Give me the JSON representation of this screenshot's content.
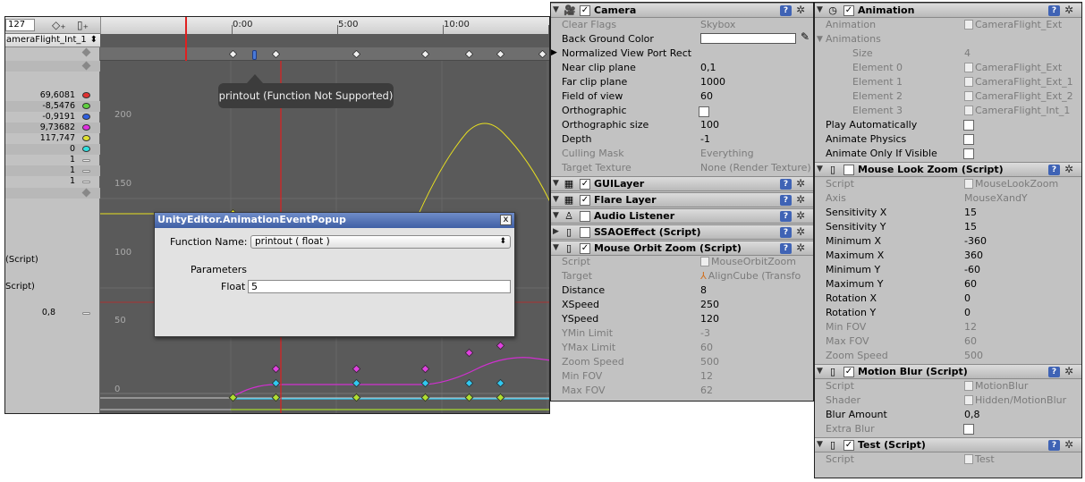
{
  "animation": {
    "frame_field": "127",
    "clip_name": "ameraFlight_Int_1",
    "ruler_labels": [
      "0:00",
      "5:00",
      "10:00"
    ],
    "tracks": [
      {
        "value": "69,6081",
        "color": "#e03030"
      },
      {
        "value": "-8,5476",
        "color": "#60d040"
      },
      {
        "value": "-0,9191",
        "color": "#3060e0"
      },
      {
        "value": "9,73682",
        "color": "#e030e0"
      },
      {
        "value": "117,747",
        "color": "#e0e030"
      },
      {
        "value": "0",
        "color": "#30e0e0"
      },
      {
        "value": "1",
        "color": ""
      },
      {
        "value": "1",
        "color": ""
      },
      {
        "value": "1",
        "color": ""
      }
    ],
    "script_label_1": "(Script)",
    "script_label_2": "Script)",
    "blur_value": "0,8",
    "y_labels": [
      "200",
      "150",
      "100",
      "50",
      "0"
    ],
    "tooltip": "printout (Function Not Supported)"
  },
  "popup": {
    "title": "UnityEditor.AnimationEventPopup",
    "close": "x",
    "function_label": "Function Name:",
    "function_value": "printout ( float )",
    "parameters_label": "Parameters",
    "float_label": "Float",
    "float_value": "5"
  },
  "inspector_a": {
    "camera": {
      "name": "Camera",
      "props": [
        {
          "label": "Clear Flags",
          "value": "Skybox",
          "dim": true
        },
        {
          "label": "Back Ground Color",
          "value": "",
          "dim": false
        },
        {
          "label": "Normalized View Port Rect",
          "value": "",
          "dim": false
        },
        {
          "label": "Near clip plane",
          "value": "0,1",
          "dim": false
        },
        {
          "label": "Far clip plane",
          "value": "1000",
          "dim": false
        },
        {
          "label": "Field of view",
          "value": "60",
          "dim": false
        },
        {
          "label": "Orthographic",
          "value": "",
          "dim": false
        },
        {
          "label": "Orthographic size",
          "value": "100",
          "dim": false
        },
        {
          "label": "Depth",
          "value": "-1",
          "dim": false
        },
        {
          "label": "Culling Mask",
          "value": "Everything",
          "dim": true
        },
        {
          "label": "Target Texture",
          "value": "None (Render Texture)",
          "dim": true
        }
      ]
    },
    "gui_layer": "GUILayer",
    "flare_layer": "Flare Layer",
    "audio_listener": "Audio Listener",
    "ssao": "SSAOEffect (Script)",
    "orbit": {
      "name": "Mouse Orbit Zoom (Script)",
      "script_label": "Script",
      "script_value": "MouseOrbitZoom",
      "target_label": "Target",
      "target_value": "AlignCube (Transfo",
      "props": [
        {
          "label": "Distance",
          "value": "8",
          "dim": false
        },
        {
          "label": "XSpeed",
          "value": "250",
          "dim": false
        },
        {
          "label": "YSpeed",
          "value": "120",
          "dim": false
        },
        {
          "label": "YMin Limit",
          "value": "-3",
          "dim": true
        },
        {
          "label": "YMax Limit",
          "value": "60",
          "dim": true
        },
        {
          "label": "Zoom Speed",
          "value": "500",
          "dim": true
        },
        {
          "label": "Min FOV",
          "value": "12",
          "dim": true
        },
        {
          "label": "Max FOV",
          "value": "62",
          "dim": true
        }
      ]
    },
    "help": "?",
    "gear": "✲"
  },
  "inspector_b": {
    "animation": {
      "name": "Animation",
      "animation_label": "Animation",
      "animation_value": "CameraFlight_Ext",
      "animations_label": "Animations",
      "size_label": "Size",
      "size_value": "4",
      "elements": [
        {
          "label": "Element 0",
          "value": "CameraFlight_Ext"
        },
        {
          "label": "Element 1",
          "value": "CameraFlight_Ext_1"
        },
        {
          "label": "Element 2",
          "value": "CameraFlight_Ext_2"
        },
        {
          "label": "Element 3",
          "value": "CameraFlight_Int_1"
        }
      ],
      "play_auto": "Play Automatically",
      "animate_physics": "Animate Physics",
      "animate_visible": "Animate Only If Visible"
    },
    "look": {
      "name": "Mouse Look Zoom (Script)",
      "script_label": "Script",
      "script_value": "MouseLookZoom",
      "axis_label": "Axis",
      "axis_value": "MouseXandY",
      "props": [
        {
          "label": "Sensitivity X",
          "value": "15",
          "dim": false
        },
        {
          "label": "Sensitivity Y",
          "value": "15",
          "dim": false
        },
        {
          "label": "Minimum X",
          "value": "-360",
          "dim": false
        },
        {
          "label": "Maximum X",
          "value": "360",
          "dim": false
        },
        {
          "label": "Minimum Y",
          "value": "-60",
          "dim": false
        },
        {
          "label": "Maximum Y",
          "value": "60",
          "dim": false
        },
        {
          "label": "Rotation X",
          "value": "0",
          "dim": false
        },
        {
          "label": "Rotation Y",
          "value": "0",
          "dim": false
        },
        {
          "label": "Min FOV",
          "value": "12",
          "dim": true
        },
        {
          "label": "Max FOV",
          "value": "60",
          "dim": true
        },
        {
          "label": "Zoom Speed",
          "value": "500",
          "dim": true
        }
      ]
    },
    "blur": {
      "name": "Motion Blur (Script)",
      "script_label": "Script",
      "script_value": "MotionBlur",
      "shader_label": "Shader",
      "shader_value": "Hidden/MotionBlur",
      "amount_label": "Blur Amount",
      "amount_value": "0,8",
      "extra_label": "Extra Blur"
    },
    "test": {
      "name": "Test (Script)",
      "script_label": "Script",
      "script_value": "Test"
    }
  }
}
